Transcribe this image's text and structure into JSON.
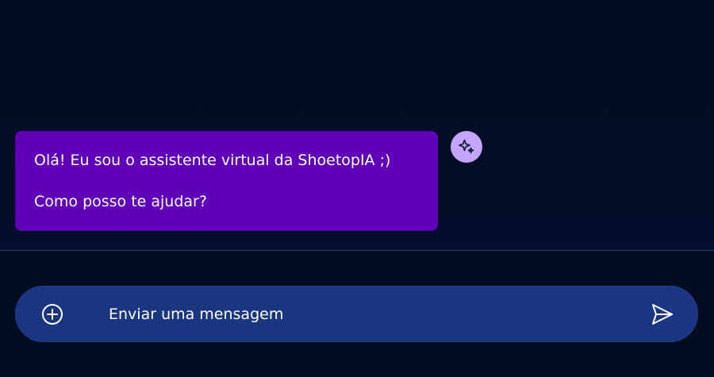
{
  "chat": {
    "messages": [
      {
        "sender": "bot",
        "lines": [
          "Olá! Eu sou o assistente virtual da ShoetopIA ;)",
          "Como posso te ajudar?"
        ]
      }
    ],
    "avatar_icon": "sparkles-icon"
  },
  "composer": {
    "placeholder": "Enviar uma mensagem",
    "value": "",
    "attach_icon": "plus-circle-icon",
    "send_icon": "send-icon"
  },
  "colors": {
    "background": "#020d22",
    "bubble": "#5f00b8",
    "avatar": "#c3a5ff",
    "composer": "#1b3681",
    "divider": "#1e3a8a"
  }
}
